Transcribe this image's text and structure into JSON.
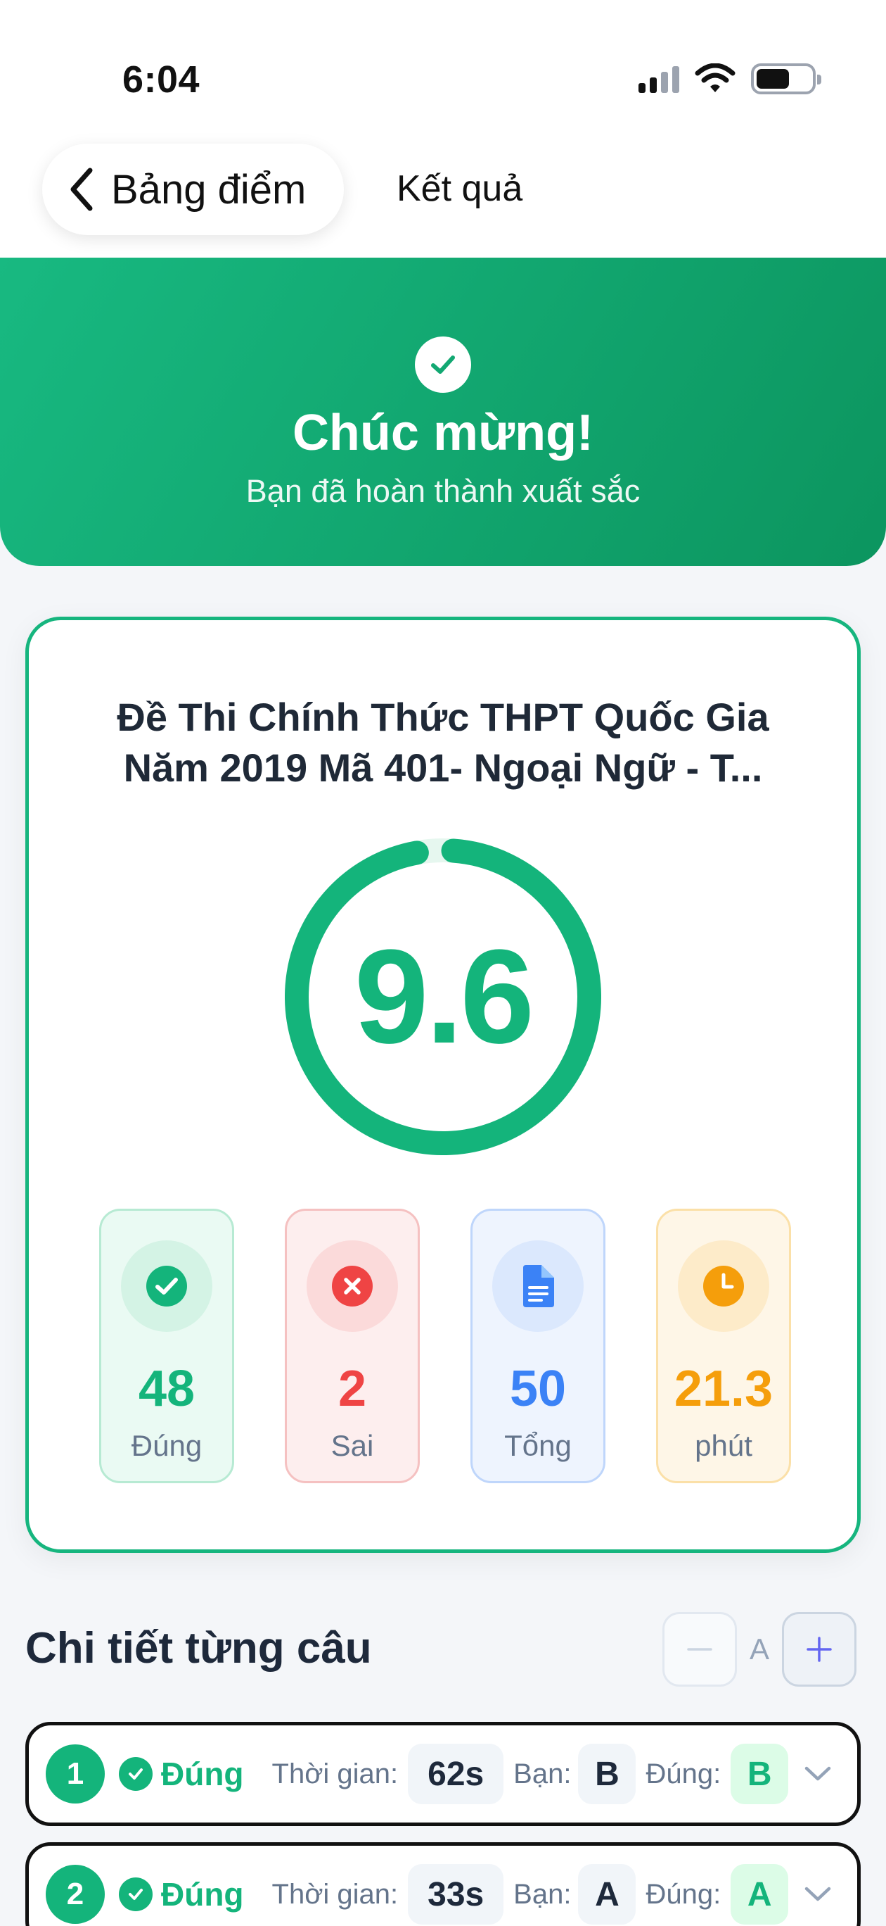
{
  "status_bar": {
    "time": "6:04"
  },
  "nav": {
    "back_label": "Bảng điểm",
    "title": "Kết quả"
  },
  "hero": {
    "title": "Chúc mừng!",
    "subtitle": "Bạn đã hoàn thành xuất sắc"
  },
  "result": {
    "exam_title_line1": "Đề Thi Chính Thức THPT Quốc Gia",
    "exam_title_line2": "Năm 2019 Mã 401- Ngoại Ngữ - T...",
    "score": "9.6",
    "score_progress": 0.96,
    "stats": [
      {
        "value": "48",
        "label": "Đúng",
        "icon": "check-circle-icon",
        "color": "#14b47b"
      },
      {
        "value": "2",
        "label": "Sai",
        "icon": "x-circle-icon",
        "color": "#ef4444"
      },
      {
        "value": "50",
        "label": "Tổng",
        "icon": "document-icon",
        "color": "#3b82f6"
      },
      {
        "value": "21.3",
        "label": "phút",
        "icon": "clock-icon",
        "color": "#f59e0b"
      }
    ]
  },
  "details": {
    "title": "Chi tiết từng câu",
    "font_size_label": "A",
    "questions": [
      {
        "number": "1",
        "status": "Đúng",
        "time_label": "Thời gian:",
        "time": "62s",
        "yours_label": "Bạn:",
        "yours": "B",
        "correct_label": "Đúng:",
        "correct": "B"
      },
      {
        "number": "2",
        "status": "Đúng",
        "time_label": "Thời gian:",
        "time": "33s",
        "yours_label": "Bạn:",
        "yours": "A",
        "correct_label": "Đúng:",
        "correct": "A"
      }
    ]
  },
  "colors": {
    "primary": "#14b47b",
    "error": "#ef4444",
    "info": "#3b82f6",
    "warning": "#f59e0b"
  }
}
